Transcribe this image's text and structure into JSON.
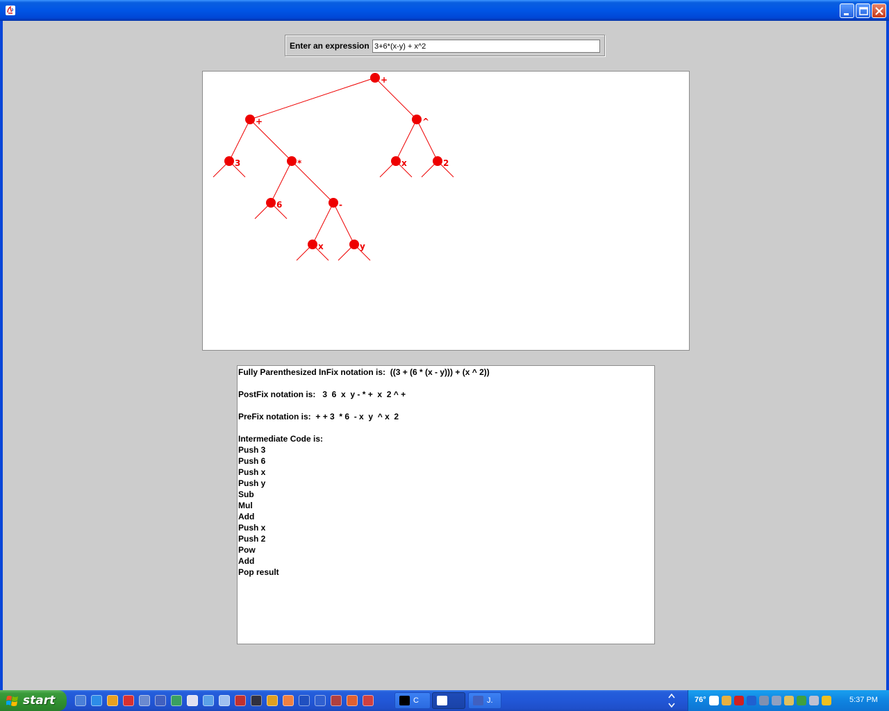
{
  "window": {
    "title": ""
  },
  "expression": {
    "label": "Enter an expression",
    "value": "3+6*(x-y) + x^2"
  },
  "tree": {
    "color": "#ee0000",
    "nodes": [
      {
        "id": "n1",
        "label": "+"
      },
      {
        "id": "n2",
        "label": "+"
      },
      {
        "id": "n3",
        "label": "^"
      },
      {
        "id": "n4",
        "label": "3"
      },
      {
        "id": "n5",
        "label": "*"
      },
      {
        "id": "n6",
        "label": "x"
      },
      {
        "id": "n7",
        "label": "2"
      },
      {
        "id": "n8",
        "label": "6"
      },
      {
        "id": "n9",
        "label": "-"
      },
      {
        "id": "n10",
        "label": "x"
      },
      {
        "id": "n11",
        "label": "y"
      }
    ],
    "edges": [
      [
        "n1",
        "n2"
      ],
      [
        "n1",
        "n3"
      ],
      [
        "n2",
        "n4"
      ],
      [
        "n2",
        "n5"
      ],
      [
        "n3",
        "n6"
      ],
      [
        "n3",
        "n7"
      ],
      [
        "n5",
        "n8"
      ],
      [
        "n5",
        "n9"
      ],
      [
        "n9",
        "n10"
      ],
      [
        "n9",
        "n11"
      ]
    ]
  },
  "output": {
    "lines": [
      "Fully Parenthesized InFix notation is:  ((3 + (6 * (x - y))) + (x ^ 2))",
      "",
      "PostFix notation is:   3  6  x  y - * +  x  2 ^ +",
      "",
      "PreFix notation is:  + + 3  * 6  - x  y  ^ x  2",
      "",
      "Intermediate Code is:",
      "Push 3",
      "Push 6",
      "Push x",
      "Push y",
      "Sub",
      "Mul",
      "Add",
      "Push x",
      "Push 2",
      "Pow",
      "Add",
      "Pop result"
    ]
  },
  "taskbar": {
    "start_label": "start",
    "tasks": [
      {
        "label": "C",
        "icon": "cmd-icon",
        "active": false
      },
      {
        "label": "",
        "icon": "java-icon",
        "active": true
      },
      {
        "label": "J.",
        "icon": "jcreator-icon",
        "active": false
      }
    ],
    "tray_temp": "76°",
    "clock": "5:37 PM"
  }
}
